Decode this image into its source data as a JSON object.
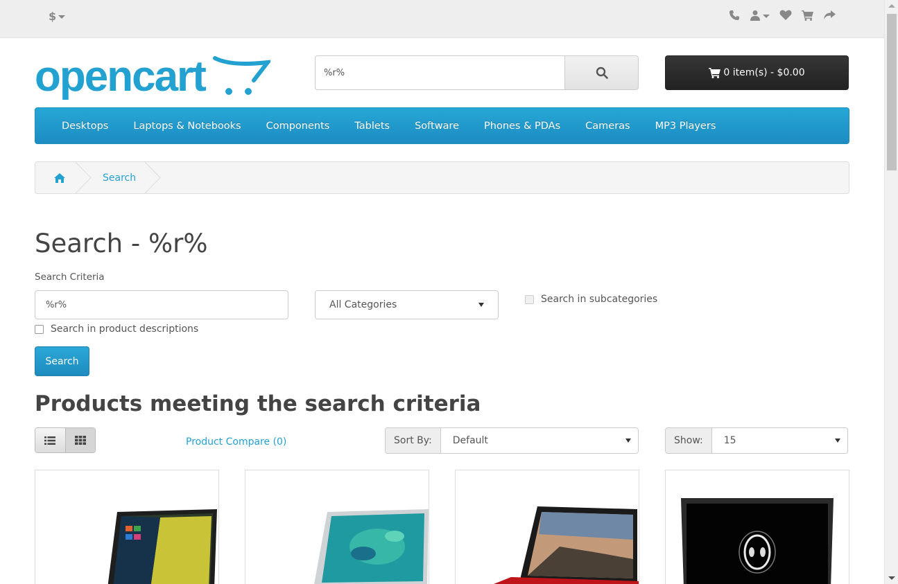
{
  "topbar": {
    "currency_symbol": "$",
    "icons": [
      "phone-icon",
      "user-icon",
      "heart-icon",
      "shopping-cart-icon",
      "share-icon"
    ]
  },
  "header": {
    "logo_text": "opencart",
    "search_value": "%r%",
    "cart_label": "0 item(s) - $0.00"
  },
  "menu": {
    "items": [
      "Desktops",
      "Laptops & Notebooks",
      "Components",
      "Tablets",
      "Software",
      "Phones & PDAs",
      "Cameras",
      "MP3 Players"
    ]
  },
  "breadcrumb": {
    "current": "Search"
  },
  "search_page": {
    "title": "Search - %r%",
    "criteria_label": "Search Criteria",
    "criteria_value": "%r%",
    "category_selected": "All Categories",
    "subcategories_label": "Search in subcategories",
    "descriptions_label": "Search in product descriptions",
    "search_button": "Search",
    "results_heading": "Products meeting the search criteria",
    "compare_link": "Product Compare (0)",
    "sort_label": "Sort By:",
    "sort_selected": "Default",
    "show_label": "Show:",
    "show_selected": "15"
  },
  "colors": {
    "brand_blue": "#23a1d1",
    "cart_dark": "#2b2b2b",
    "topbar_bg": "#eeeeee"
  }
}
